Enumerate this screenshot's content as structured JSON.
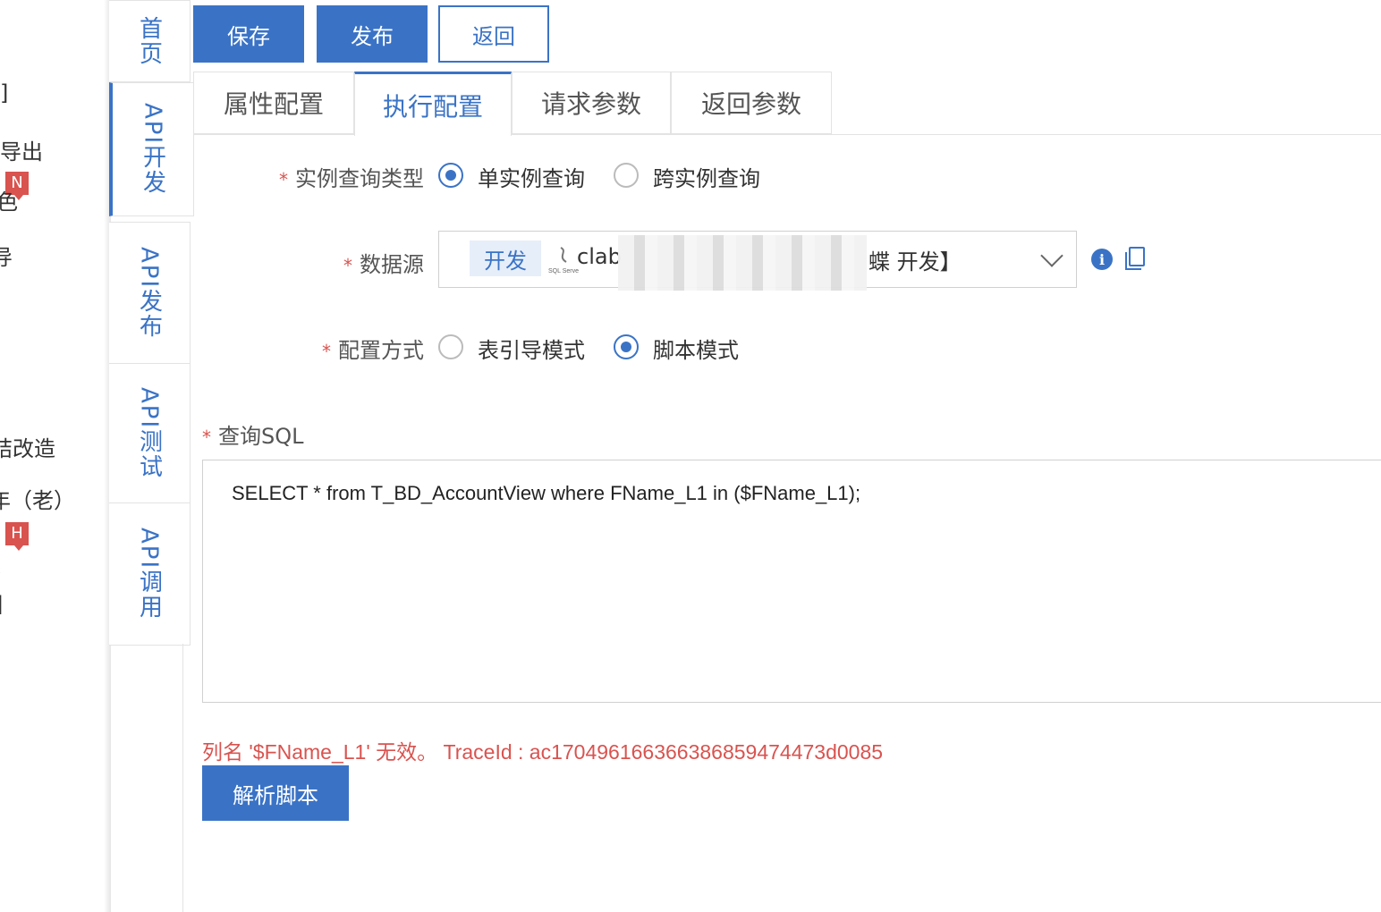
{
  "left_sidebar": {
    "items": [
      {
        "text": "]"
      },
      {
        "text": "导出"
      },
      {
        "text": "色"
      },
      {
        "text": "导"
      },
      {
        "text": "结改造"
      },
      {
        "text": "年（老）"
      },
      {
        "text": "、"
      },
      {
        "text": "]"
      }
    ],
    "badges": [
      "N",
      "H"
    ]
  },
  "vertical_tabs": [
    {
      "label": "首页"
    },
    {
      "label": "API开发"
    },
    {
      "label": "API发布"
    },
    {
      "label": "API测试"
    },
    {
      "label": "API调用"
    }
  ],
  "toolbar": {
    "save": "保存",
    "publish": "发布",
    "back": "返回"
  },
  "tabs": [
    {
      "label": "属性配置"
    },
    {
      "label": "执行配置"
    },
    {
      "label": "请求参数"
    },
    {
      "label": "返回参数"
    }
  ],
  "form": {
    "required_mark": "*",
    "instance_type": {
      "label": "实例查询类型",
      "options": [
        "单实例查询",
        "跨实例查询"
      ],
      "selected": "单实例查询"
    },
    "datasource": {
      "label": "数据源",
      "env_tag": "开发",
      "db_type": "SQL Server",
      "value_visible": "clab",
      "value_suffix": "蝶 开发】"
    },
    "config_mode": {
      "label": "配置方式",
      "options": [
        "表引导模式",
        "脚本模式"
      ],
      "selected": "脚本模式"
    },
    "sql": {
      "label": "查询SQL",
      "value": "SELECT * from T_BD_AccountView where FName_L1  in ($FName_L1);"
    }
  },
  "error_message": "列名 '$FName_L1' 无效。 TraceId : ac170496166366386859474473d0085",
  "parse_button": "解析脚本",
  "colors": {
    "primary": "#3a73c6",
    "error": "#d9534f",
    "border": "#e3e3e3"
  }
}
